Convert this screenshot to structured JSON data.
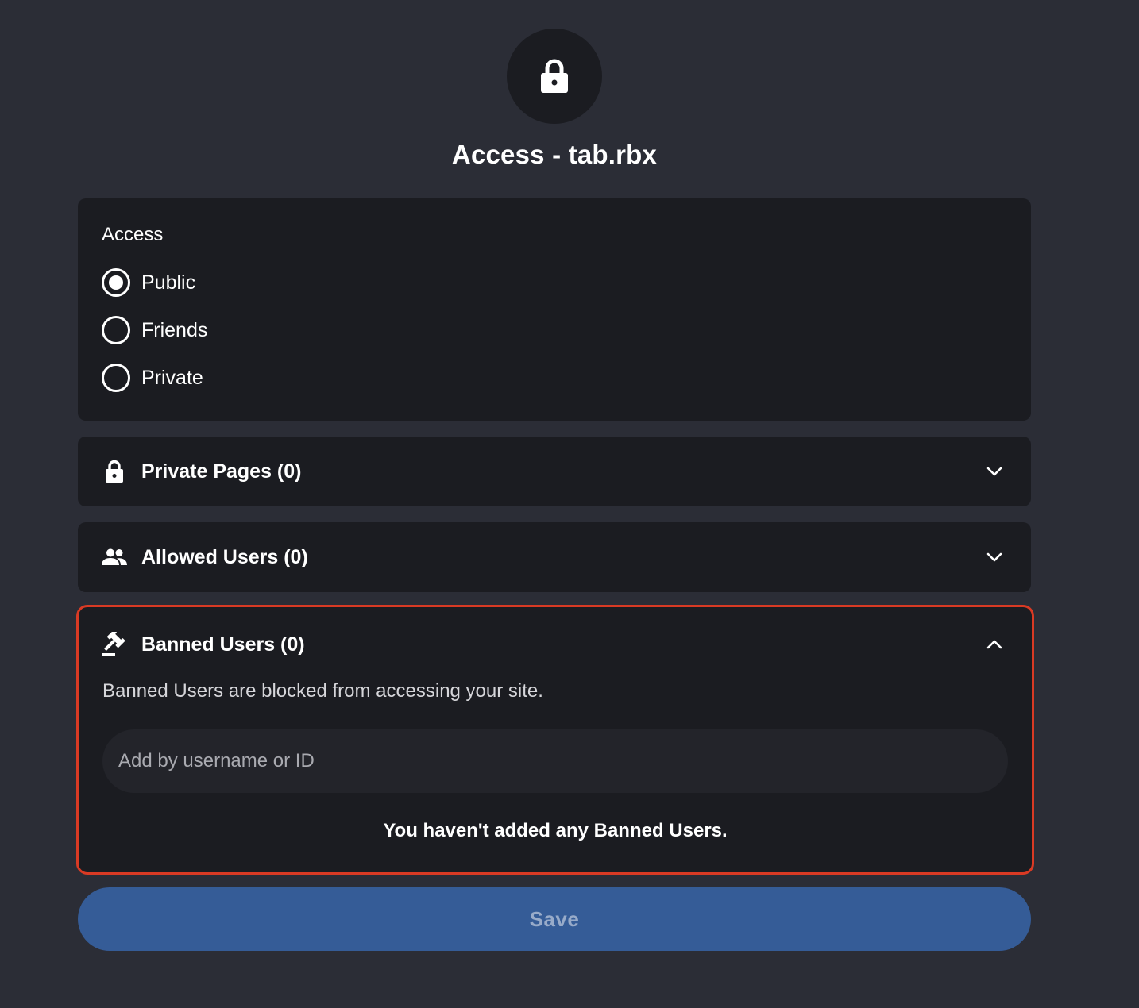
{
  "header": {
    "icon": "lock-icon",
    "title": "Access - tab.rbx"
  },
  "access": {
    "label": "Access",
    "options": [
      {
        "label": "Public",
        "selected": true
      },
      {
        "label": "Friends",
        "selected": false
      },
      {
        "label": "Private",
        "selected": false
      }
    ]
  },
  "sections": {
    "private_pages": {
      "title": "Private Pages (0)",
      "icon": "lock-icon",
      "expanded": false
    },
    "allowed_users": {
      "title": "Allowed Users (0)",
      "icon": "users-icon",
      "expanded": false
    },
    "banned_users": {
      "title": "Banned Users (0)",
      "icon": "gavel-icon",
      "expanded": true,
      "description": "Banned Users are blocked from accessing your site.",
      "input_placeholder": "Add by username or ID",
      "input_value": "",
      "empty_message": "You haven't added any Banned Users."
    }
  },
  "save": {
    "label": "Save"
  },
  "colors": {
    "background": "#2b2d36",
    "card": "#1b1c21",
    "highlight_border": "#d93a24",
    "save_button": "#355c97",
    "save_text": "#98abc9"
  }
}
